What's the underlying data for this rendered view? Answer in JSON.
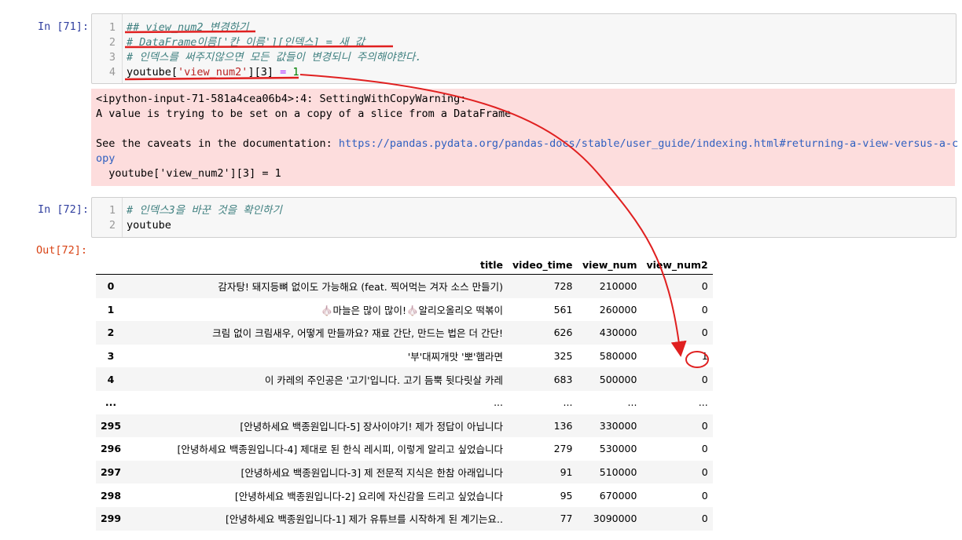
{
  "cell71": {
    "prompt": "In [71]:",
    "lines": [
      {
        "num": "1",
        "text": "## view_num2 변경하기"
      },
      {
        "num": "2",
        "text": "# DataFrame이름['칸 이름'][인덱스] = 새 값"
      },
      {
        "num": "3",
        "text": "# 인덱스를 써주지않으면 모든 값들이 변경되니 주의해야한다."
      },
      {
        "num": "4",
        "code": {
          "p1": "youtube[",
          "p2": "'view_num2'",
          "p3": "][3] ",
          "p4": "=",
          "p5": " ",
          "p6": "1"
        }
      }
    ]
  },
  "stderr": {
    "line1": "<ipython-input-71-581a4cea06b4>:4: SettingWithCopyWarning:",
    "line2": "A value is trying to be set on a copy of a slice from a DataFrame",
    "line4_prefix": "See the caveats in the documentation: ",
    "link_part1": "https://pandas.pydata.org/pandas-docs/stable/user_guide/indexing.html#returning-a-view-versus-a-c",
    "link_part2": "opy",
    "line6": "  youtube['view_num2'][3] = 1"
  },
  "cell72": {
    "prompt": "In [72]:",
    "out_prompt": "Out[72]:",
    "lines": [
      {
        "num": "1",
        "text": "# 인덱스3을 바꾼 것을 확인하기"
      },
      {
        "num": "2",
        "text": "youtube"
      }
    ]
  },
  "table": {
    "columns": [
      "",
      "title",
      "video_time",
      "view_num",
      "view_num2"
    ],
    "rows": [
      {
        "idx": "0",
        "title": "감자탕! 돼지등뼈 없이도 가능해요 (feat. 찍어먹는 겨자 소스 만들기)",
        "video_time": "728",
        "view_num": "210000",
        "view_num2": "0"
      },
      {
        "idx": "1",
        "title": "🧄마늘은 많이 많이!🧄알리오올리오 떡볶이",
        "video_time": "561",
        "view_num": "260000",
        "view_num2": "0"
      },
      {
        "idx": "2",
        "title": "크림 없이 크림새우, 어떻게 만들까요? 재료 간단, 만드는 법은 더 간단!",
        "video_time": "626",
        "view_num": "430000",
        "view_num2": "0"
      },
      {
        "idx": "3",
        "title": "'부'대찌개맛 '뽀'햄라면",
        "video_time": "325",
        "view_num": "580000",
        "view_num2": "1"
      },
      {
        "idx": "4",
        "title": "이 카레의 주인공은 '고기'입니다. 고기 듬뿍 뒷다릿살 카레",
        "video_time": "683",
        "view_num": "500000",
        "view_num2": "0"
      },
      {
        "idx": "...",
        "title": "...",
        "video_time": "...",
        "view_num": "...",
        "view_num2": "..."
      },
      {
        "idx": "295",
        "title": "[안녕하세요 백종원입니다-5] 장사이야기! 제가 정답이 아닙니다",
        "video_time": "136",
        "view_num": "330000",
        "view_num2": "0"
      },
      {
        "idx": "296",
        "title": "[안녕하세요 백종원입니다-4] 제대로 된 한식 레시피, 이렇게 알리고 싶었습니다",
        "video_time": "279",
        "view_num": "530000",
        "view_num2": "0"
      },
      {
        "idx": "297",
        "title": "[안녕하세요 백종원입니다-3] 제 전문적 지식은 한참 아래입니다",
        "video_time": "91",
        "view_num": "510000",
        "view_num2": "0"
      },
      {
        "idx": "298",
        "title": "[안녕하세요 백종원입니다-2] 요리에 자신감을 드리고 싶었습니다",
        "video_time": "95",
        "view_num": "670000",
        "view_num2": "0"
      },
      {
        "idx": "299",
        "title": "[안녕하세요 백종원입니다-1] 제가 유튜브를 시작하게 된 계기는요..",
        "video_time": "77",
        "view_num": "3090000",
        "view_num2": "0"
      }
    ]
  },
  "colors": {
    "annotation": "#e02020",
    "prompt_in": "#303f9f",
    "prompt_out": "#d84315",
    "stderr_bg": "#fddddd"
  }
}
